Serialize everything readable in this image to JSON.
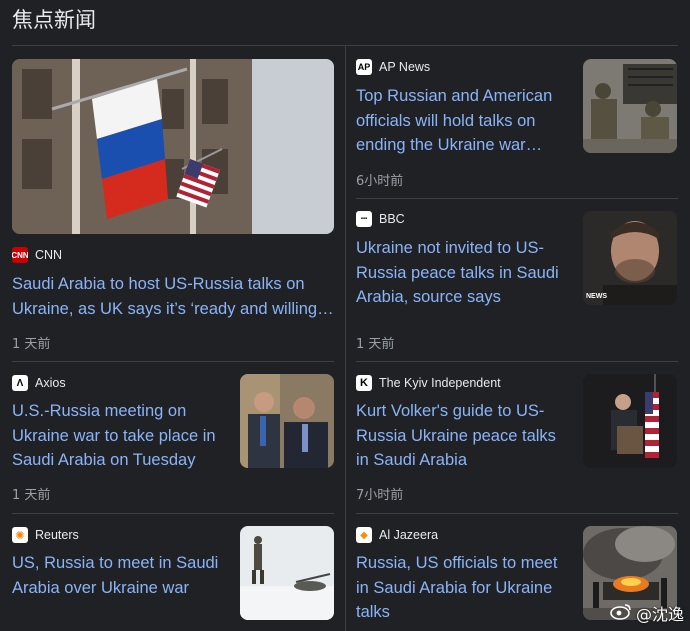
{
  "header": {
    "title": "焦点新闻"
  },
  "articles": [
    {
      "source": "CNN",
      "logo_text": "CNN",
      "logo_color": "#cc0000",
      "headline": "Saudi Arabia to host US-Russia talks on Ukraine, as UK says it’s ‘ready and willing…",
      "time": "1 天前",
      "image": "russian-and-us-flags-on-building"
    },
    {
      "source": "AP News",
      "logo_text": "AP",
      "logo_color": "#ffffff",
      "headline": "Top Russian and American officials will hold talks on ending the Ukraine war…",
      "time": "6小时前",
      "image": "soldiers-with-rocket-launcher"
    },
    {
      "source": "BBC",
      "logo_text": "▪▪▪",
      "logo_color": "#ffffff",
      "headline": "Ukraine not invited to US-Russia peace talks in Saudi Arabia, source says",
      "time": "1 天前",
      "image": "zelensky-portrait",
      "image_caption": "NEWS"
    },
    {
      "source": "Axios",
      "logo_text": "Λ",
      "logo_color": "#ffffff",
      "headline": "U.S.-Russia meeting on Ukraine war to take place in Saudi Arabia on Tuesday",
      "time": "1 天前",
      "image": "two-officials-in-suits"
    },
    {
      "source": "The Kyiv Independent",
      "logo_text": "K",
      "logo_color": "#ffffff",
      "headline": "Kurt Volker's guide to US-Russia Ukraine peace talks in Saudi Arabia",
      "time": "7小时前",
      "image": "speaker-at-podium-with-us-flag"
    },
    {
      "source": "Reuters",
      "logo_text": "✺",
      "logo_color": "#ff8000",
      "headline": "US, Russia to meet in Saudi Arabia over Ukraine war",
      "time": "",
      "image": "soldier-in-snow-field"
    },
    {
      "source": "Al Jazeera",
      "logo_text": "◆",
      "logo_color": "#fa9000",
      "headline": "Russia, US officials to meet in Saudi Arabia for Ukraine talks",
      "time": "",
      "image": "burning-vehicle-in-smoke"
    }
  ],
  "watermark": {
    "text": "@沈逸"
  }
}
